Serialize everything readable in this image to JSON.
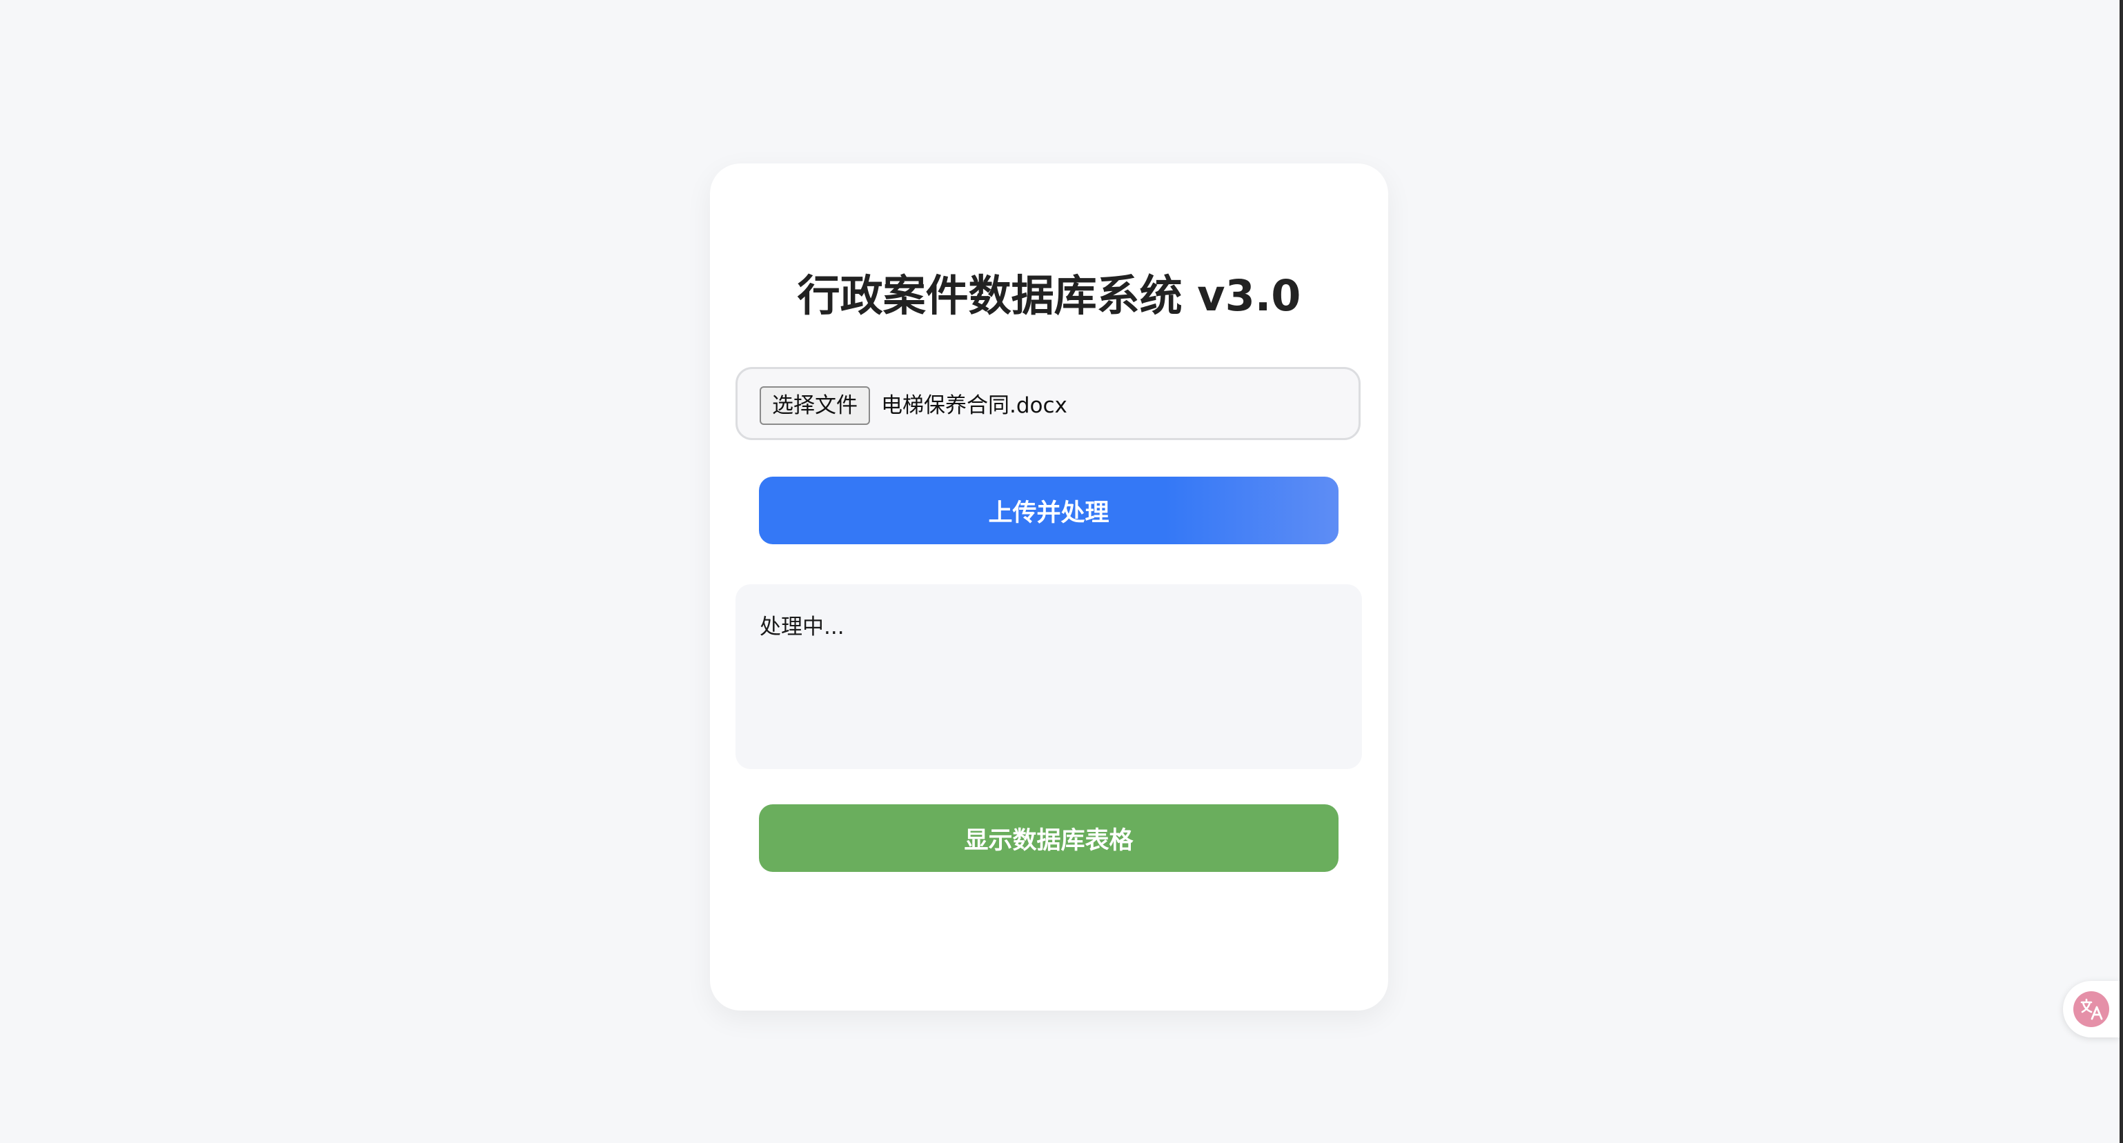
{
  "app": {
    "title": "行政案件数据库系统 v3.0"
  },
  "file_input": {
    "button_label": "选择文件",
    "selected_file": "电梯保养合同.docx"
  },
  "actions": {
    "upload_label": "上传并处理",
    "show_db_label": "显示数据库表格"
  },
  "status": {
    "text": "处理中..."
  },
  "colors": {
    "upload_button": "#3478f6",
    "db_button": "#6aae5d",
    "background": "#f6f7f9",
    "translate_icon": "#e590a8"
  },
  "icons": {
    "translate": "translate-icon"
  }
}
